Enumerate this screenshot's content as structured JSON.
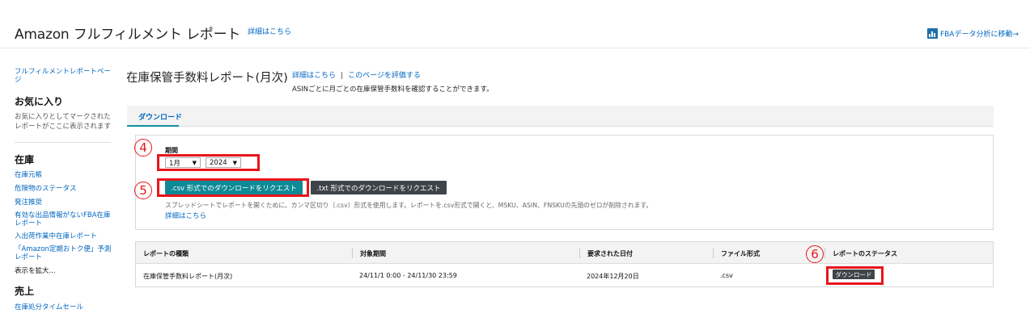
{
  "header": {
    "app_title": "Amazon フルフィルメント レポート",
    "details_link": "詳細はこちら",
    "fba_link": "FBAデータ分析に移動→",
    "fba_icon": "bar-chart-icon"
  },
  "sidebar": {
    "reports_link": "フルフィルメントレポートページ",
    "favorites_heading": "お気に入り",
    "favorites_text": "お気に入りとしてマークされたレポートがここに表示されます",
    "inventory_heading": "在庫",
    "inventory_items": [
      "在庫元帳",
      "危険物のステータス",
      "発注推奨",
      "有効な出品情報がないFBA在庫レポート",
      "入出荷作業中在庫レポート",
      "「Amazon定期おトク便」予測レポート",
      "表示を拡大..."
    ],
    "sales_heading": "売上",
    "sales_items": [
      "在庫処分タイムセール"
    ]
  },
  "main": {
    "title": "在庫保管手数料レポート(月次)",
    "details_link": "詳細はこちら",
    "separator": "|",
    "rate_link": "このページを評価する",
    "subtitle": "ASINごとに月ごとの在庫保管手数料を確認することができます。",
    "tab_download": "ダウンロード",
    "period_label": "期間",
    "month_value": "1月",
    "year_value": "2024",
    "csv_button": ".csv 形式でのダウンロードをリクエスト",
    "txt_button": ".txt 形式でのダウンロードをリクエスト",
    "hint": "スプレッドシートでレポートを開くために、カンマ区切り（.csv）形式を使用します。レポートを.csv形式で開くと、MSKU、ASIN、FNSKUの先頭のゼロが削除されます。",
    "hint_link": "詳細はこちら"
  },
  "table": {
    "headers": [
      "レポートの種類",
      "対象期間",
      "要求された日付",
      "ファイル形式",
      "レポートのステータス"
    ],
    "row": {
      "type": "在庫保管手数料レポート(月次)",
      "period": "24/11/1 0:00 - 24/11/30 23:59",
      "requested": "2024年12月20日",
      "format": ".csv",
      "status_button": "ダウンロード"
    }
  },
  "annotations": {
    "n4": "4",
    "n5": "5",
    "n6": "6",
    "color": "#e8151b"
  }
}
